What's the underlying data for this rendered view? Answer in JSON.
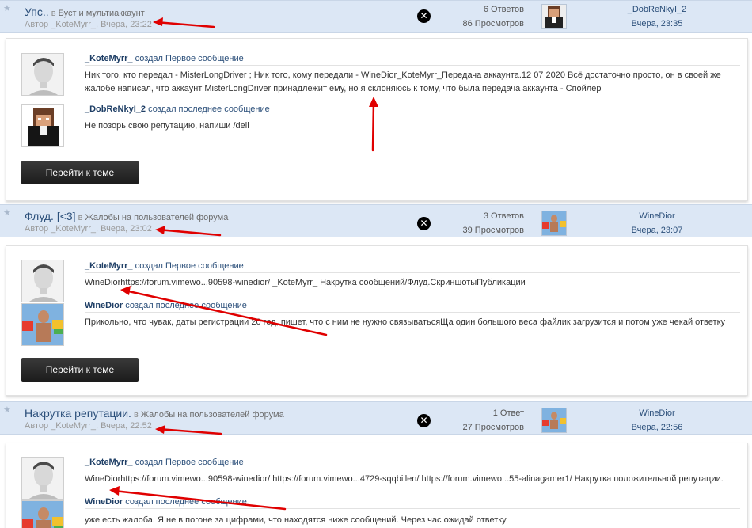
{
  "colors": {
    "accent": "#2b4f7a",
    "row_bg": "#dce7f5",
    "annotation": "#e00000"
  },
  "threads": [
    {
      "title": "Упс..",
      "in_prefix": "в",
      "forum": "Буст и мультиаккаунт",
      "meta": "Автор _KoteMyrr_, Вчера, 23:22",
      "replies": "6 Ответов",
      "views": "86 Просмотров",
      "last_user": "_DobReNkyI_2",
      "last_time": "Вчера, 23:35",
      "first_post": {
        "user": "_KoteMyrr_",
        "action": "создал Первое сообщение",
        "text": "Ник того, кто передал - MisterLongDriver ; Ник того, кому передали - WineDior_KoteMyrr_Передача аккаунта.12 07 2020 Всё достаточно просто, он в своей же жалобе написал, что аккаунт MisterLongDriver принадлежит ему, но я склоняюсь к тому, что была передача аккаунта - Спойлер"
      },
      "last_post": {
        "user": "_DobReNkyI_2",
        "action": "создал последнее сообщение",
        "text": "Не позорь свою репутацию, напиши /dell"
      },
      "button": "Перейти к теме"
    },
    {
      "title": "Флуд. [<3]",
      "in_prefix": "в",
      "forum": "Жалобы на пользователей форума",
      "meta": "Автор _KoteMyrr_, Вчера, 23:02",
      "replies": "3 Ответов",
      "views": "39 Просмотров",
      "last_user": "WineDior",
      "last_time": "Вчера, 23:07",
      "first_post": {
        "user": "_KoteMyrr_",
        "action": "создал Первое сообщение",
        "text": "WineDiorhttps://forum.vimewo...90598-winedior/ _KoteMyrr_ Накрутка сообщений/Флуд.СкриншотыПубликации"
      },
      "last_post": {
        "user": "WineDior",
        "action": "создал последнее сообщение",
        "text": "Прикольно, что чувак, даты регистрации 20 год, пишет, что с ним не нужно связыватьсяЩа один большого веса файлик загрузится и потом уже чекай ответку"
      },
      "button": "Перейти к теме"
    },
    {
      "title": "Накрутка репутации.",
      "in_prefix": "в",
      "forum": "Жалобы на пользователей форума",
      "meta": "Автор _KoteMyrr_, Вчера, 22:52",
      "replies": "1 Ответ",
      "views": "27 Просмотров",
      "last_user": "WineDior",
      "last_time": "Вчера, 22:56",
      "first_post": {
        "user": "_KoteMyrr_",
        "action": "создал Первое сообщение",
        "text": "WineDiorhttps://forum.vimewo...90598-winedior/ https://forum.vimewo...4729-sqqbillen/ https://forum.vimewo...55-alinagamer1/ Накрутка положительной репутации."
      },
      "last_post": {
        "user": "WineDior",
        "action": "создал последнее сообщение",
        "text": "уже есть жалоба. Я не в погоне за цифрами, что находятся ниже сообщений. Через час ожидай ответку"
      }
    }
  ]
}
